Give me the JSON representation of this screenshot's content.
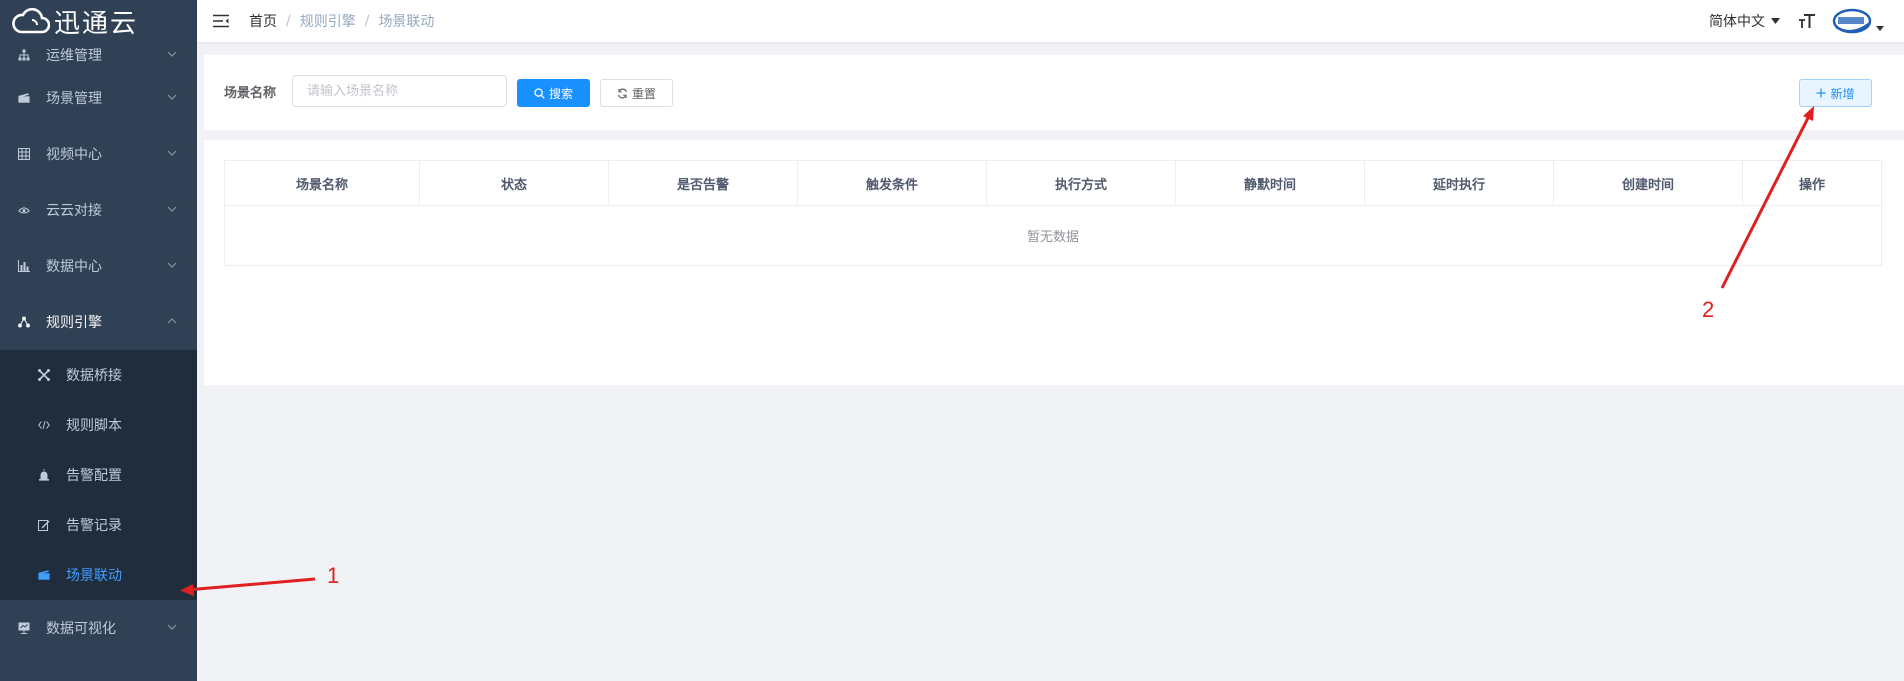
{
  "app": {
    "logo_text": "迅通云"
  },
  "sidebar": {
    "items": [
      {
        "label": "运维管理",
        "icon": "sitemap-icon"
      },
      {
        "label": "场景管理",
        "icon": "clapperboard-icon"
      },
      {
        "label": "视频中心",
        "icon": "grid-icon"
      },
      {
        "label": "云云对接",
        "icon": "cloud-eye-icon"
      },
      {
        "label": "数据中心",
        "icon": "bar-chart-icon"
      },
      {
        "label": "规则引擎",
        "icon": "share-icon"
      }
    ],
    "submenu": [
      {
        "label": "数据桥接",
        "icon": "bridge-icon"
      },
      {
        "label": "规则脚本",
        "icon": "code-icon"
      },
      {
        "label": "告警配置",
        "icon": "alarm-icon"
      },
      {
        "label": "告警记录",
        "icon": "edit-icon"
      },
      {
        "label": "场景联动",
        "icon": "clapperboard-icon"
      }
    ],
    "last_item": {
      "label": "数据可视化",
      "icon": "monitor-icon"
    }
  },
  "header": {
    "breadcrumb": [
      "首页",
      "规则引擎",
      "场景联动"
    ],
    "separator": "/",
    "language": "简体中文"
  },
  "search": {
    "label": "场景名称",
    "placeholder": "请输入场景名称",
    "search_button": "搜索",
    "reset_button": "重置",
    "add_button": "新增"
  },
  "table": {
    "columns": [
      "场景名称",
      "状态",
      "是否告警",
      "触发条件",
      "执行方式",
      "静默时间",
      "延时执行",
      "创建时间",
      "操作"
    ],
    "empty_text": "暂无数据"
  },
  "annotations": {
    "label1": "1",
    "label2": "2",
    "color": "#e02020"
  },
  "colors": {
    "sidebar_bg": "#304156",
    "submenu_bg": "#1f2d3d",
    "active": "#409eff",
    "primary": "#1890ff"
  }
}
